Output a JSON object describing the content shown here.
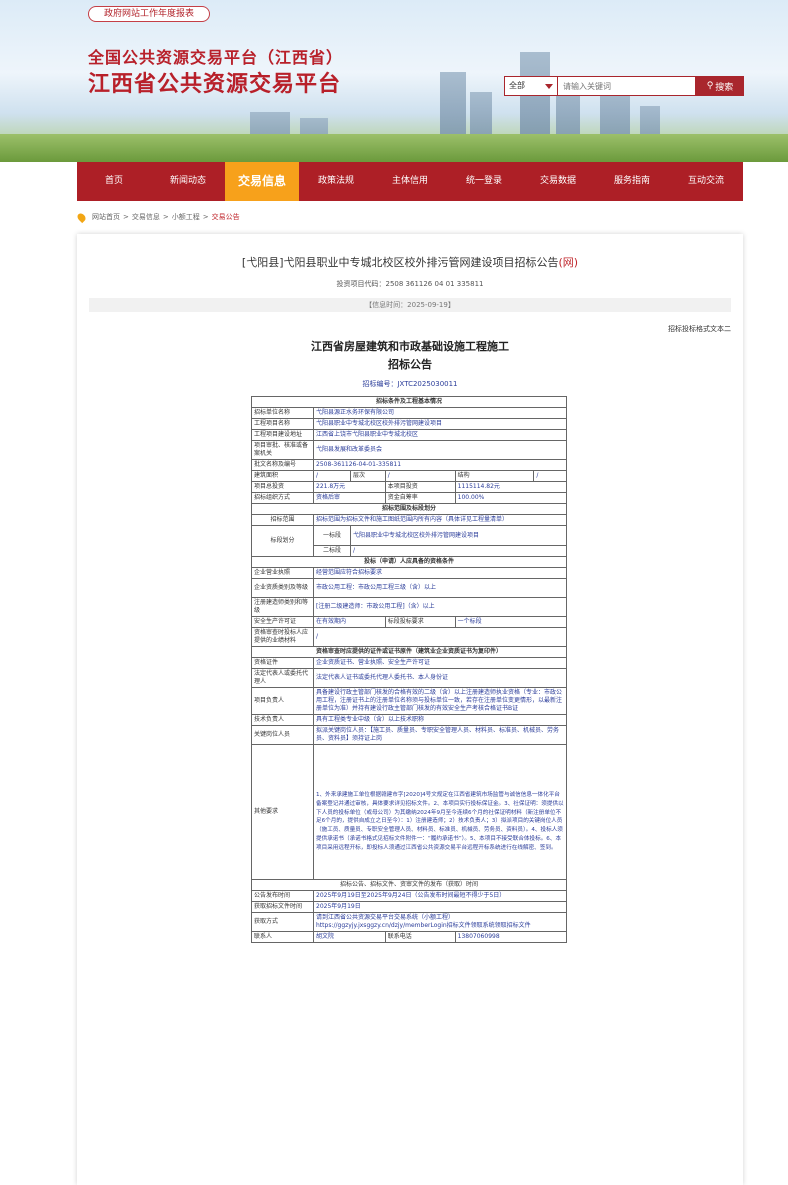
{
  "header": {
    "annual_report": "政府网站工作年度报表",
    "title_line1": "全国公共资源交易平台（江西省）",
    "title_line2": "江西省公共资源交易平台"
  },
  "search": {
    "scope": "全部",
    "placeholder": "请输入关键词",
    "button": "搜索"
  },
  "nav": {
    "items": [
      "首页",
      "新闻动态",
      "交易信息",
      "政策法规",
      "主体信用",
      "统一登录",
      "交易数据",
      "服务指南",
      "互动交流"
    ],
    "active": "交易信息"
  },
  "breadcrumb": [
    "网站首页",
    "交易信息",
    "小额工程",
    "交易公告"
  ],
  "article": {
    "title_prefix": "[弋阳县]弋阳县职业中专城北校区校外排污管网建设项目招标公告",
    "title_suffix": "(网)",
    "code": "投资项目代码：2508 361126 04 01 335811",
    "date": "【信息时间：2025-09-19】",
    "template": "招标投标格式文本二",
    "doc_title1": "江西省房屋建筑和市政基础设施工程施工",
    "doc_title2": "招标公告",
    "doc_no": "招标编号：JXTC2025030011"
  },
  "table": {
    "sec1": "招标条件及工程基本情况",
    "r1": [
      "招标单位名称",
      "弋阳县源正水务环保有限公司"
    ],
    "r2": [
      "工程项目名称",
      "弋阳县职业中专城北校区校外排污管网建设项目"
    ],
    "r3": [
      "工程项目建设地址",
      "江西省上饶市弋阳县职业中专城北校区"
    ],
    "r4": [
      "项目审批、核准或备案机关",
      "弋阳县发展和改革委员会"
    ],
    "r5": [
      "批文名称及编号",
      "2508-361126-04-01-335811"
    ],
    "r6": [
      "建筑面积",
      "/",
      "层次",
      "/",
      "结构",
      "/"
    ],
    "r7": [
      "项目总投资",
      "221.8万元",
      "本项目投资",
      "1115114.82元"
    ],
    "r8": [
      "招标组织方式",
      "资格后审",
      "资金自筹率",
      "100.00%"
    ],
    "sec2": "招标范围及标段划分",
    "r9": [
      "招标范围",
      "招标范围为招标文件和施工图纸范围内所有内容（具体详见工程量清单）"
    ],
    "r10": [
      "标段划分",
      "一标段",
      "弋阳县职业中专城北校区校外排污管网建设项目",
      "二标段",
      "/"
    ],
    "sec3": "投标（申请）人应具备的资格条件",
    "r11": [
      "企业营业执照",
      "经营范围应符合招标要求"
    ],
    "r12": [
      "企业资质类别及等级",
      "市政公用工程：市政公用工程三级（含）以上"
    ],
    "r13": [
      "注册建造师类别和等级",
      "[注册二级建造师：市政公用工程]（含）以上"
    ],
    "r14": [
      "安全生产许可证",
      "在有效期内",
      "标段投标要求",
      "一个标段"
    ],
    "r15": [
      "资格审查时投标人应提供的业绩材料",
      "/"
    ],
    "sec4": "资格审查时应提供的证件或证书原件（建筑业企业资质证书为复印件）",
    "r16": [
      "资格证件",
      "企业资质证书、营业执照、安全生产许可证"
    ],
    "r17": [
      "法定代表人或委托代理人",
      "法定代表人证书或委托代理人委托书、本人身份证"
    ],
    "r18": [
      "项目负责人",
      "具备建设行政主管部门核发的合格有效的二级（含）以上注册建造师执业资格（专业：市政公用工程，注册证书上的注册单位名称须与投标单位一致，若存在注册单位变更情形，以最新注册单位为准）并持有建设行政主管部门核发的有效安全生产考核合格证书B证"
    ],
    "r19": [
      "技术负责人",
      "具有工程类专业中级（含）以上技术职称"
    ],
    "r20": [
      "关键岗位人员",
      "拟派关键岗位人员：【施工员、质量员、专职安全管理人员、材料员、标准员、机械员、劳务员、资料员】须持证上岗"
    ],
    "r21": [
      "其他要求",
      "1、外来承建施工单位根据赣建市字[2020]4号文规定在江西省建筑市场监管与诚信信息一体化平台备案登记并通过审核，具体要求详见招标文件。2、本项目实行投标保证金。3、社保证明：须提供以下人员的投标单位（或母公司）为其缴纳2024年9月至今连续6个月的社保证明材料（新注册单位不足6个月的，提供自成立之日至今）：1）注册建造师；2）技术负责人；3）拟派项目的关键岗位人员（施工员、质量员、专职安全管理人员、材料员、标准员、机械员、劳务员、资料员）。4、投标人须提供承诺书（承诺书格式见招标文件附件一：“履约承诺书”）。5、本项目不接受联合体投标。6、本项目采用远程开标，即投标人须通过江西省公共资源交易平台远程开标系统进行在线解密、签到。"
    ],
    "sec5": "招标公告、招标文件、资审文件的发布（获取）时间",
    "r22": [
      "公告发布时间",
      "2025年9月19日至2025年9月24日（公告发布时间最短不得少于5日）"
    ],
    "r23": [
      "获取招标文件时间",
      "2025年9月19日"
    ],
    "r24": [
      "获取方式",
      "请到江西省公共资源交易平台交易系统（小额工程）https://ggzyjy.jxsggzy.cn/dzjy/memberLogin招标文件领取系统领取招标文件"
    ],
    "r25": [
      "联系人",
      "胡文院",
      "联系电话",
      "13807060998"
    ]
  }
}
